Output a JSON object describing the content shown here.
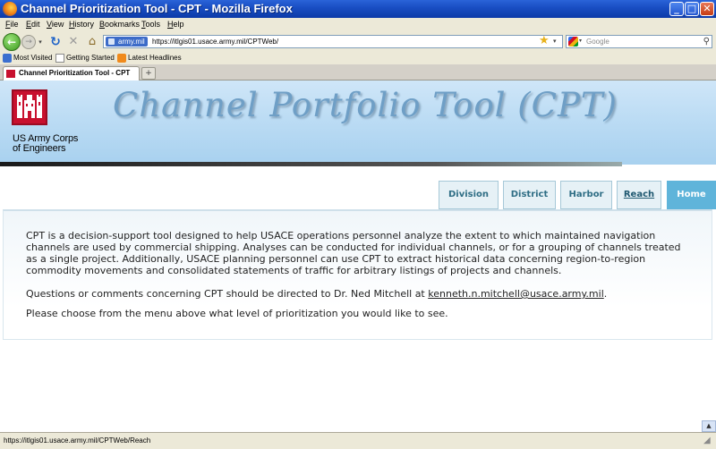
{
  "window": {
    "title": "Channel Prioritization Tool - CPT - Mozilla Firefox",
    "minimize": "_",
    "maximize": "□",
    "close": "✕"
  },
  "menu": [
    "File",
    "Edit",
    "View",
    "History",
    "Bookmarks",
    "Tools",
    "Help"
  ],
  "toolbar": {
    "identity": "army.mil",
    "url": "https://itlgis01.usace.army.mil/CPTWeb/",
    "search_placeholder": "Google"
  },
  "bookmarks": [
    "Most Visited",
    "Getting Started",
    "Latest Headlines"
  ],
  "tabs": [
    {
      "label": "Channel Prioritization Tool - CPT"
    }
  ],
  "header": {
    "org_line1": "US Army Corps",
    "org_line2": "of Engineers",
    "app_title": "Channel Portfolio Tool (CPT)"
  },
  "nav": {
    "division": "Division",
    "district": "District",
    "harbor": "Harbor",
    "reach": "Reach",
    "home": "Home"
  },
  "content": {
    "para1": "CPT is a decision-support tool designed to help USACE operations personnel analyze the extent to which maintained navigation channels are used by commercial shipping. Analyses can be conducted for individual channels, or for a grouping of channels treated as a single project. Additionally, USACE planning personnel can use CPT to extract historical data concerning region-to-region commodity movements and consolidated statements of traffic for arbitrary listings of projects and channels.",
    "para2_prefix": "Questions or comments concerning CPT should be directed to Dr. Ned Mitchell at ",
    "email": "kenneth.n.mitchell@usace.army.mil",
    "para2_suffix": ".",
    "para3": "Please choose from the menu above what level of prioritization you would like to see."
  },
  "status": {
    "text": "https://itlgis01.usace.army.mil/CPTWeb/Reach"
  },
  "colors": {
    "titlebar": "#1a4fc4",
    "banner": "#bcdcf4",
    "nav_text": "#2f6e85",
    "home_tab": "#5fb4da",
    "logo_red": "#c8102e"
  }
}
